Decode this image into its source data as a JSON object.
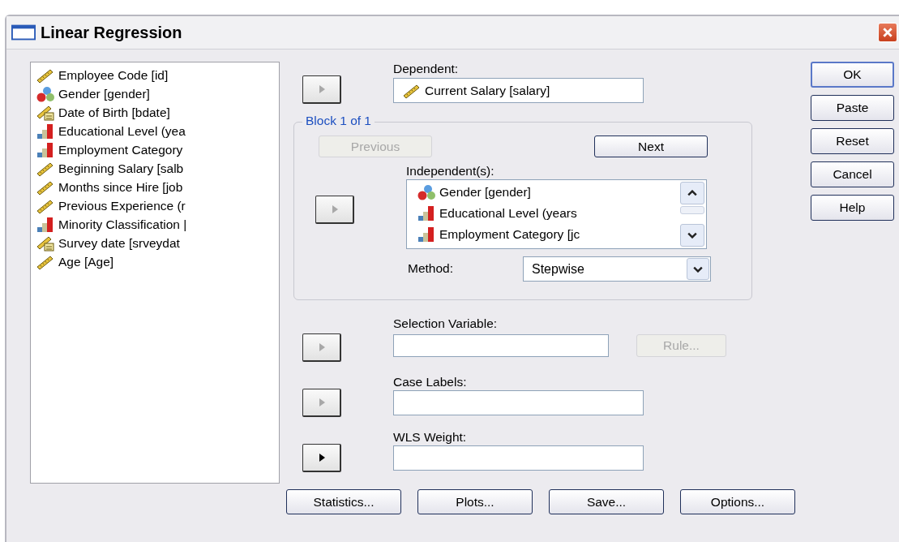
{
  "window": {
    "title": "Linear Regression"
  },
  "variables": [
    {
      "label": "Employee Code [id]",
      "kind": "scale"
    },
    {
      "label": "Gender [gender]",
      "kind": "nominal"
    },
    {
      "label": "Date of Birth [bdate]",
      "kind": "date"
    },
    {
      "label": "Educational Level (yea",
      "kind": "ordinal"
    },
    {
      "label": "Employment Category",
      "kind": "ordinal"
    },
    {
      "label": "Beginning Salary [salb",
      "kind": "scale"
    },
    {
      "label": "Months since Hire [job",
      "kind": "scale"
    },
    {
      "label": "Previous Experience (r",
      "kind": "scale"
    },
    {
      "label": "Minority Classification |",
      "kind": "ordinal"
    },
    {
      "label": "Survey date [srveydat",
      "kind": "date"
    },
    {
      "label": "Age [Age]",
      "kind": "scale"
    }
  ],
  "dependent": {
    "label": "Dependent:",
    "arrow_disabled": true,
    "value": {
      "label": "Current Salary [salary]",
      "kind": "scale"
    }
  },
  "block": {
    "title": "Block 1 of 1",
    "previous": {
      "label": "Previous",
      "disabled": true
    },
    "next": {
      "label": "Next",
      "disabled": false
    },
    "independents_label": "Independent(s):",
    "arrow_disabled": true,
    "independents": [
      {
        "label": "Gender [gender]",
        "kind": "nominal"
      },
      {
        "label": "Educational Level (years",
        "kind": "ordinal"
      },
      {
        "label": "Employment Category [jc",
        "kind": "ordinal"
      }
    ],
    "method_label": "Method:",
    "method": "Stepwise"
  },
  "selection": {
    "label": "Selection Variable:",
    "arrow_disabled": true,
    "rule": {
      "label": "Rule...",
      "disabled": true
    }
  },
  "case_labels": {
    "label": "Case Labels:",
    "arrow_disabled": true
  },
  "wls": {
    "label": "WLS Weight:",
    "arrow_disabled": false
  },
  "bottom_buttons": [
    "Statistics...",
    "Plots...",
    "Save...",
    "Options..."
  ],
  "side_buttons": [
    "OK",
    "Paste",
    "Reset",
    "Cancel",
    "Help"
  ]
}
